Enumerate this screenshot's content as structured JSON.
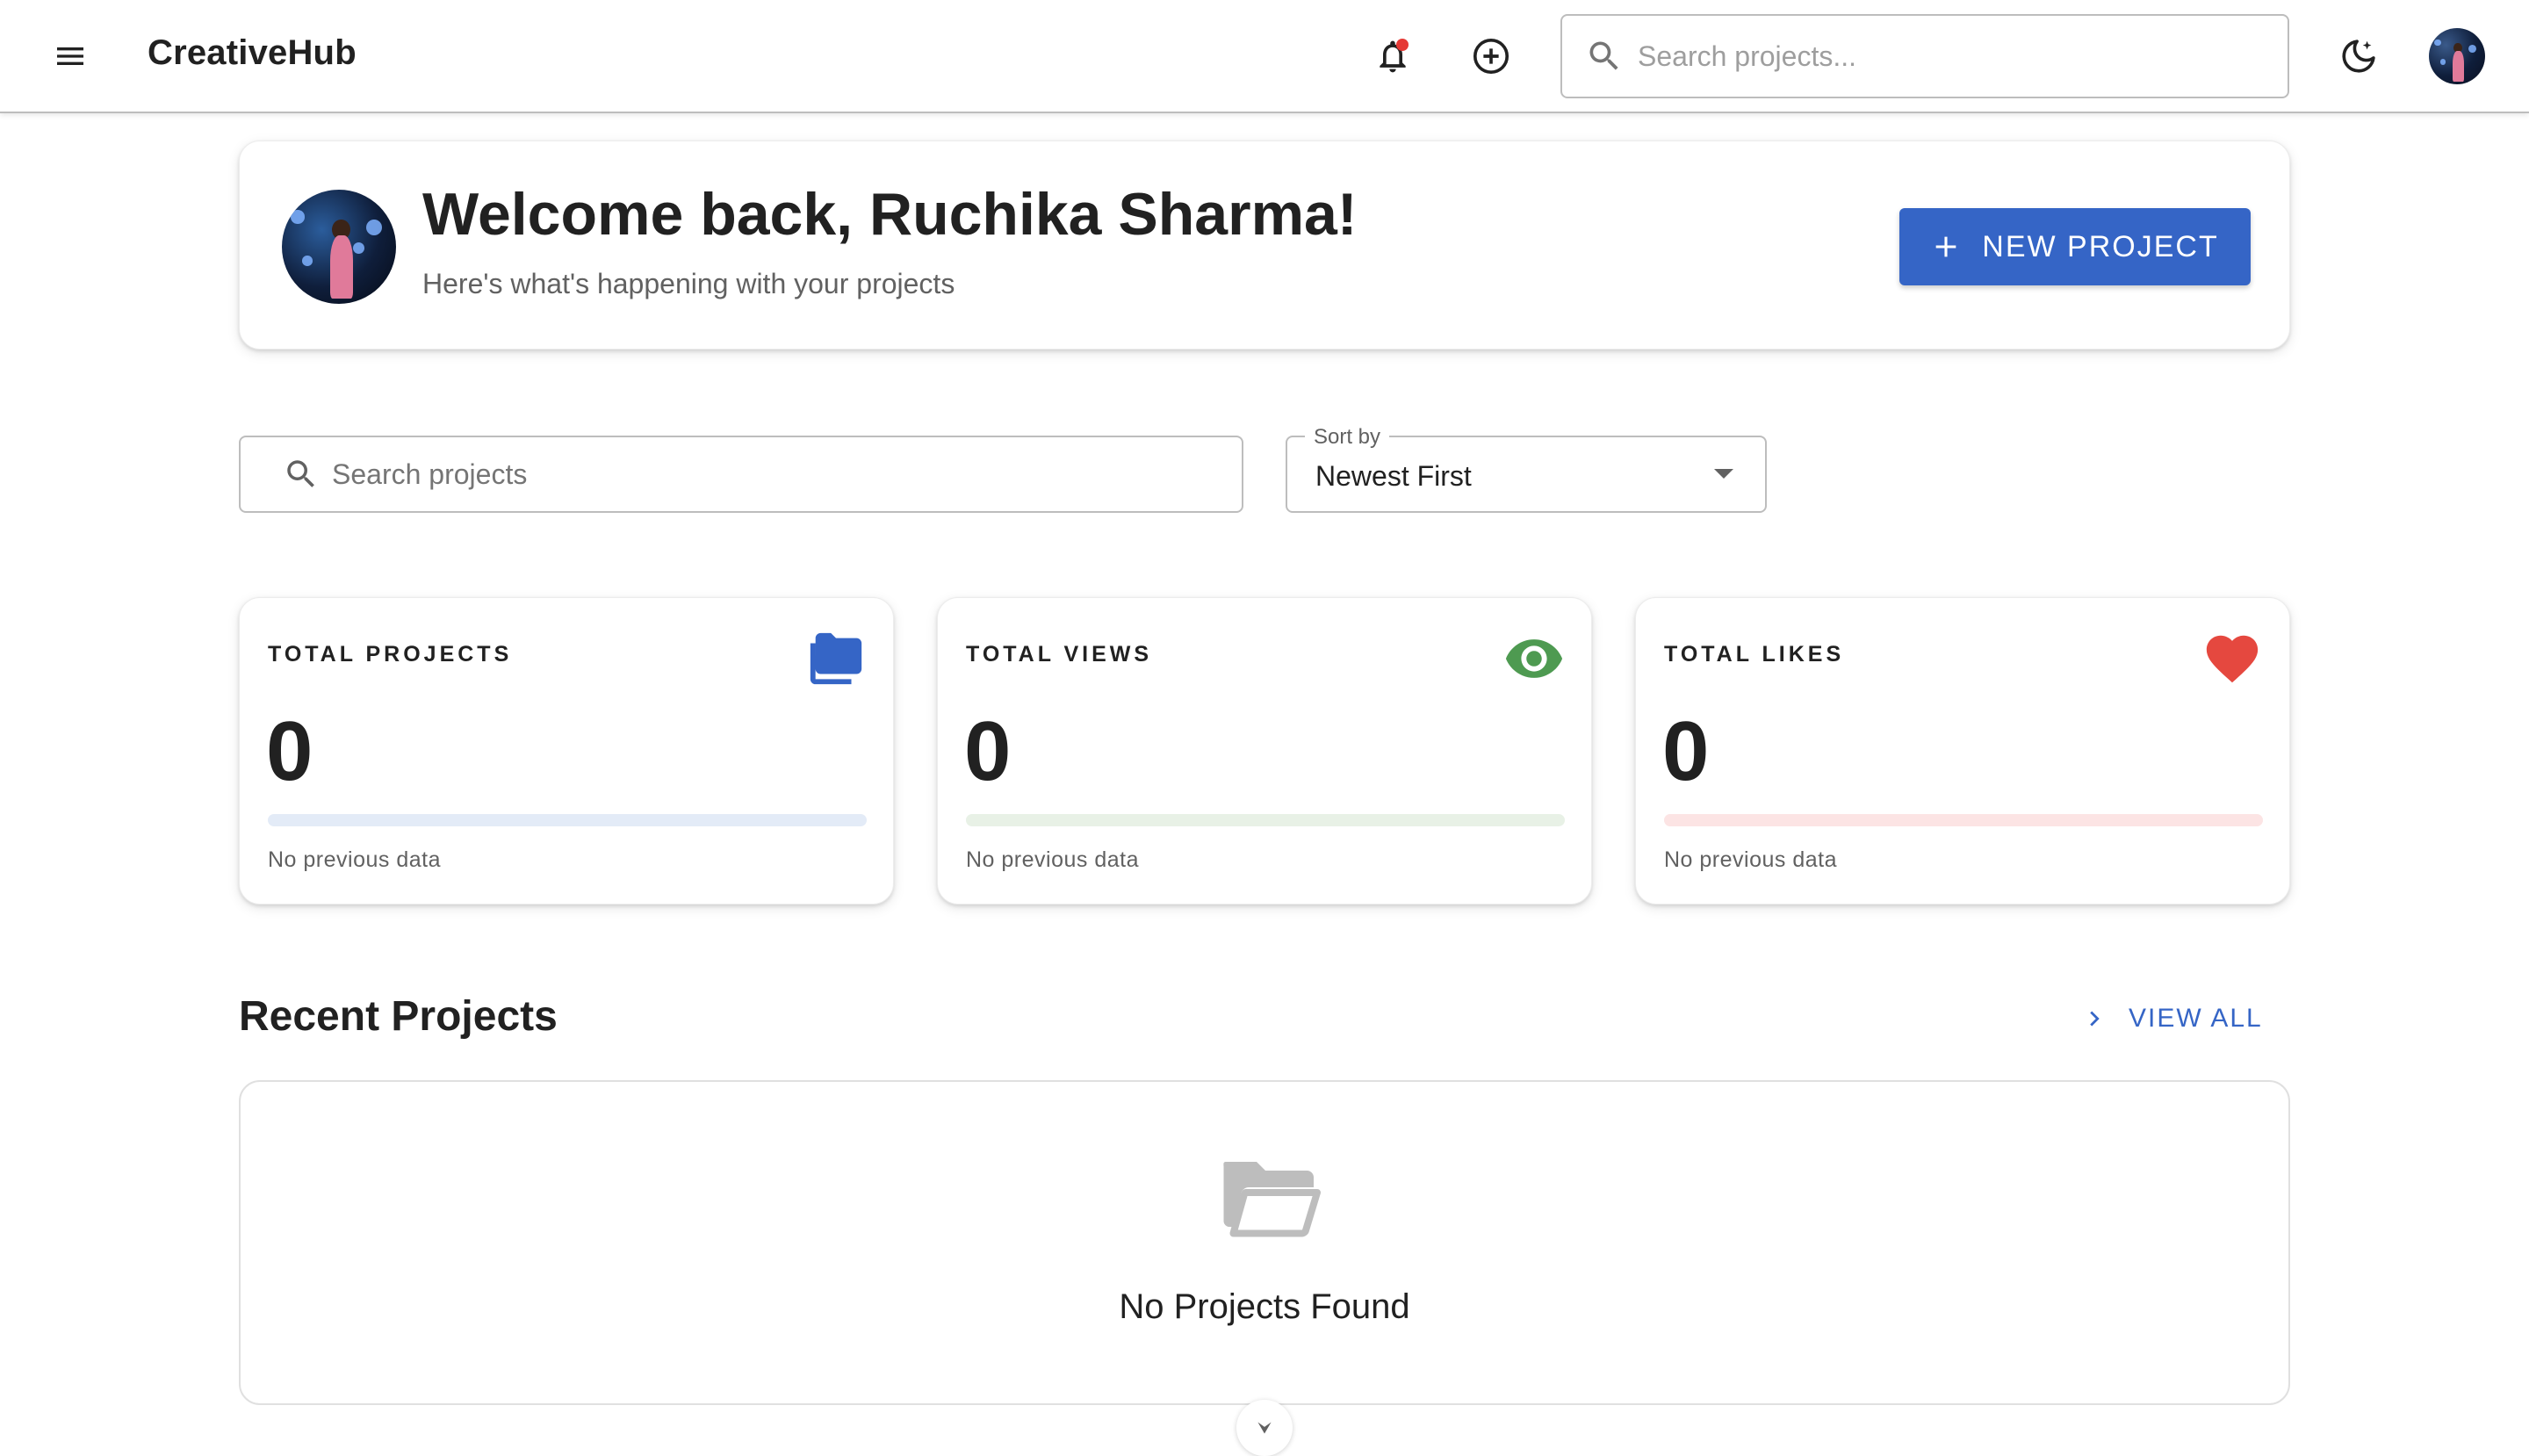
{
  "app": {
    "brand": "CreativeHub",
    "search_placeholder": "Search projects..."
  },
  "icons": {
    "menu": "menu-icon",
    "notifications": "bell-icon",
    "add": "add-circle-icon",
    "theme": "dark-mode-icon",
    "search": "search-icon",
    "folder": "folder-icon",
    "views": "eye-icon",
    "likes": "heart-icon",
    "empty": "folder-open-icon"
  },
  "colors": {
    "primary": "#3565c6",
    "views_green": "#4e9a51",
    "likes_red": "#e5483f",
    "notification_dot": "#e53935"
  },
  "welcome": {
    "title": "Welcome back, Ruchika Sharma!",
    "subtitle": "Here's what's happening with your projects",
    "new_project_label": "NEW PROJECT"
  },
  "filters": {
    "search_placeholder": "Search projects",
    "sort_label": "Sort by",
    "sort_value": "Newest First"
  },
  "stats": [
    {
      "label": "TOTAL PROJECTS",
      "value": "0",
      "note": "No previous data",
      "progress": 0,
      "bar_color": "#e3ebf7",
      "icon": "folder-icon"
    },
    {
      "label": "TOTAL VIEWS",
      "value": "0",
      "note": "No previous data",
      "progress": 0,
      "bar_color": "#e8f1e6",
      "icon": "eye-icon"
    },
    {
      "label": "TOTAL LIKES",
      "value": "0",
      "note": "No previous data",
      "progress": 0,
      "bar_color": "#fce4e4",
      "icon": "heart-icon"
    }
  ],
  "recent": {
    "title": "Recent Projects",
    "view_all_label": "VIEW ALL",
    "empty_text": "No Projects Found"
  }
}
